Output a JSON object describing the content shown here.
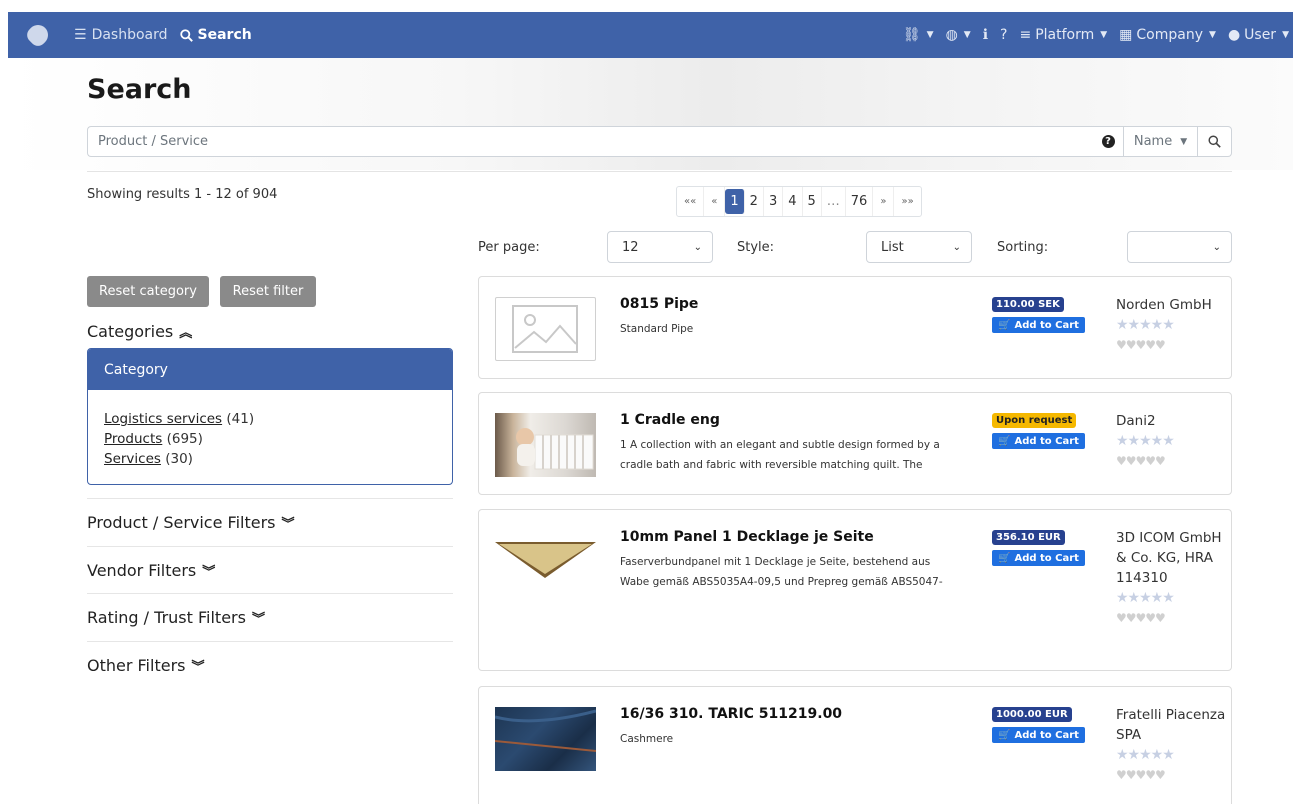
{
  "nav": {
    "dashboard": "Dashboard",
    "search": "Search",
    "platform": "Platform",
    "company": "Company",
    "user": "User"
  },
  "page": {
    "title": "Search"
  },
  "search": {
    "placeholder": "Product / Service",
    "mode": "Name"
  },
  "results": {
    "summary": "Showing results 1 - 12 of 904"
  },
  "pagination": {
    "first": "««",
    "prev": "«",
    "pages": [
      "1",
      "2",
      "3",
      "4",
      "5",
      "…",
      "76"
    ],
    "next": "»",
    "last": "»»",
    "current": "1"
  },
  "controls": {
    "per_page_label": "Per page:",
    "per_page_value": "12",
    "style_label": "Style:",
    "style_value": "List",
    "sorting_label": "Sorting:",
    "sorting_value": ""
  },
  "sidebar": {
    "reset_category": "Reset category",
    "reset_filter": "Reset filter",
    "categories_heading": "Categories",
    "category_box_title": "Category",
    "categories": [
      {
        "name": "Logistics services",
        "count": "(41)"
      },
      {
        "name": "Products",
        "count": "(695)"
      },
      {
        "name": "Services",
        "count": "(30)"
      }
    ],
    "filters": [
      "Product / Service Filters",
      "Vendor Filters",
      "Rating / Trust Filters",
      "Other Filters"
    ]
  },
  "products": [
    {
      "title": "0815 Pipe",
      "desc": "Standard Pipe",
      "price": "110.00 SEK",
      "price_type": "price",
      "cart": "Add to Cart",
      "vendor": "Norden GmbH",
      "image": "placeholder"
    },
    {
      "title": "1 Cradle eng",
      "desc": "1 A collection with an elegant and subtle design formed by a cradle bath and fabric with reversible matching quilt. The",
      "price": "Upon request",
      "price_type": "request",
      "cart": "Add to Cart",
      "vendor": "Dani2",
      "image": "cradle-photo"
    },
    {
      "title": "10mm Panel 1 Decklage je Seite",
      "desc": "Faserverbundpanel mit 1 Decklage je Seite, bestehend aus Wabe gemäß ABS5035A4-09,5 und Prepreg gemäß ABS5047-",
      "price": "356.10 EUR",
      "price_type": "price",
      "cart": "Add to Cart",
      "vendor": "3D ICOM GmbH & Co. KG, HRA 114310",
      "image": "panel-photo"
    },
    {
      "title": "16/36 310. TARIC 511219.00",
      "desc": "Cashmere",
      "price": "1000.00 EUR",
      "price_type": "price",
      "cart": "Add to Cart",
      "vendor": "Fratelli Piacenza SPA",
      "image": "fabric-photo"
    }
  ],
  "colors": {
    "primary": "#3f62a8",
    "cart_button": "#1f6fe0",
    "price_badge": "#27418f",
    "request_badge": "#f5b800",
    "reset_button": "#8a8a8a"
  }
}
